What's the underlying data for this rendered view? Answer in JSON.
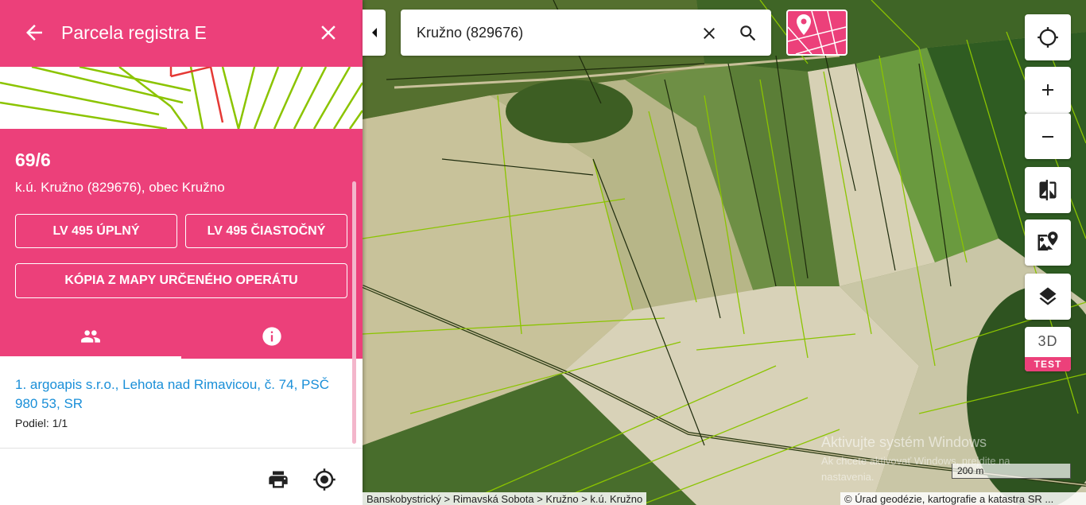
{
  "header": {
    "title": "Parcela registra E"
  },
  "parcel": {
    "number": "69/6",
    "location": "k.ú. Kružno (829676), obec Kružno"
  },
  "buttons": {
    "lv_full": "LV 495 ÚPLNÝ",
    "lv_partial": "LV 495 ČIASTOČNÝ",
    "map_copy": "KÓPIA Z MAPY URČENÉHO OPERÁTU"
  },
  "tabs": [
    {
      "icon": "people-icon",
      "active": true
    },
    {
      "icon": "info-icon",
      "active": false
    }
  ],
  "owners": [
    {
      "text": "1. argoapis s.r.o., Lehota nad Rimavicou, č. 74, PSČ 980 53, SR",
      "share": "Podiel: 1/1"
    }
  ],
  "bottom_actions": [
    {
      "icon": "print-icon"
    },
    {
      "icon": "locate-icon"
    }
  ],
  "search": {
    "value": "Kružno (829676)"
  },
  "map_controls": {
    "three_d": "3D",
    "test_badge": "TEST"
  },
  "watermark": {
    "line1": "Aktivujte systém Windows",
    "line2": "Ak chcete aktivovať Windows, prejdite na nastavenia."
  },
  "scale": {
    "label": "200 m"
  },
  "breadcrumb": "Banskobystrický > Rimavská Sobota > Kružno > k.ú. Kružno",
  "attribution": "© Úrad geodézie, kartografie a katastra SR ...",
  "colors": {
    "accent": "#ec407a",
    "link": "#1a8fd8",
    "parcel_line": "#8bc400"
  }
}
